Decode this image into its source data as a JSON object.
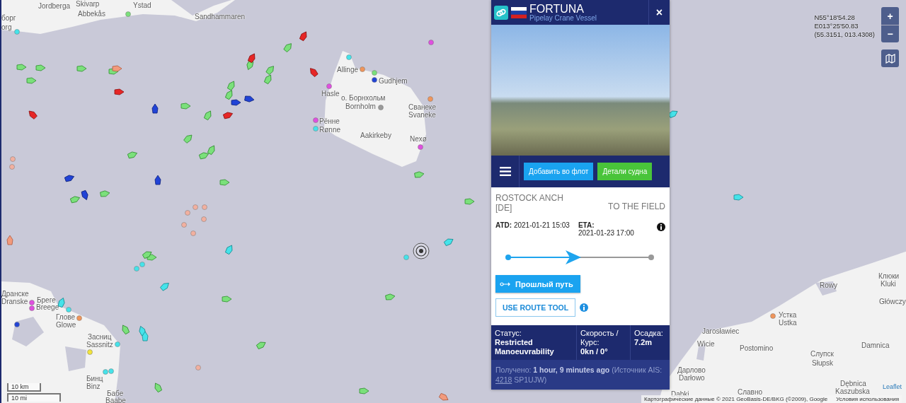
{
  "map": {
    "labels": [
      "Jordberga",
      "Skivarp",
      "Ystad",
      "борг",
      "Abbekås",
      "Sandhammaren",
      "org",
      "Allinge",
      "Gudhjem",
      "Hasle",
      "о. Борнхольм",
      "Bornholm",
      "Сванеке",
      "Svaneke",
      "Рённе",
      "Rønne",
      "Aakirkeby",
      "Nexø",
      "Дранске",
      "Dranske",
      "Брегe",
      "Breege",
      "Глове",
      "Glowe",
      "Засниц",
      "Sassnitz",
      "Бинц",
      "Binz",
      "Бабе",
      "Baabe",
      "Rowy",
      "Клюки",
      "Kluki",
      "Główczy",
      "Устка",
      "Ustka",
      "Jarosławiec",
      "Wicie",
      "Postomino",
      "Damnica",
      "Слупск",
      "Słupsk",
      "Дарлово",
      "Darłowo",
      "Dąbki",
      "Славно",
      "Dębnica",
      "Kaszubska"
    ],
    "coordinates": [
      "N55°18'54.28",
      "E013°25'50.83",
      "(55.3151, 013.4308)"
    ],
    "zoom_in": "+",
    "zoom_out": "−",
    "scale": [
      "10 km",
      "10 mi"
    ],
    "attribution": {
      "text": "Картографические данные © 2021 GeoBasis-DE/BKG (©2009), Google",
      "terms": "Условия использования",
      "leaflet": "Leaflet"
    }
  },
  "vessel_popup": {
    "name": "FORTUNA",
    "type": "Pipelay Crane Vessel",
    "close": "×",
    "actions": [
      {
        "label": "Добавить во флот",
        "kind": "fleet"
      },
      {
        "label": "Детали судна",
        "kind": "details"
      }
    ],
    "departure": "ROSTOCK ANCH [DE]",
    "destination": "TO THE FIELD",
    "atd_label": "ATD:",
    "atd": "2021-01-21 15:03",
    "eta_label": "ETA:",
    "eta": "2021-01-23 17:00",
    "progress": {
      "level": 0.5
    },
    "past_track": "Прошлый путь",
    "route_tool": "USE ROUTE TOOL",
    "stats": [
      {
        "label": "Статус:",
        "value": "Restricted Manoeuvrability"
      },
      {
        "label": "Скорость / Курс:",
        "value": "0kn / 0°"
      },
      {
        "label": "Осадка:",
        "value": "7.2m"
      }
    ],
    "received": {
      "text": "Получено: **1 hour, 9 minutes ago** (Источник AIS:",
      "link": "4218",
      "suffix": "SP1UJW)"
    }
  }
}
